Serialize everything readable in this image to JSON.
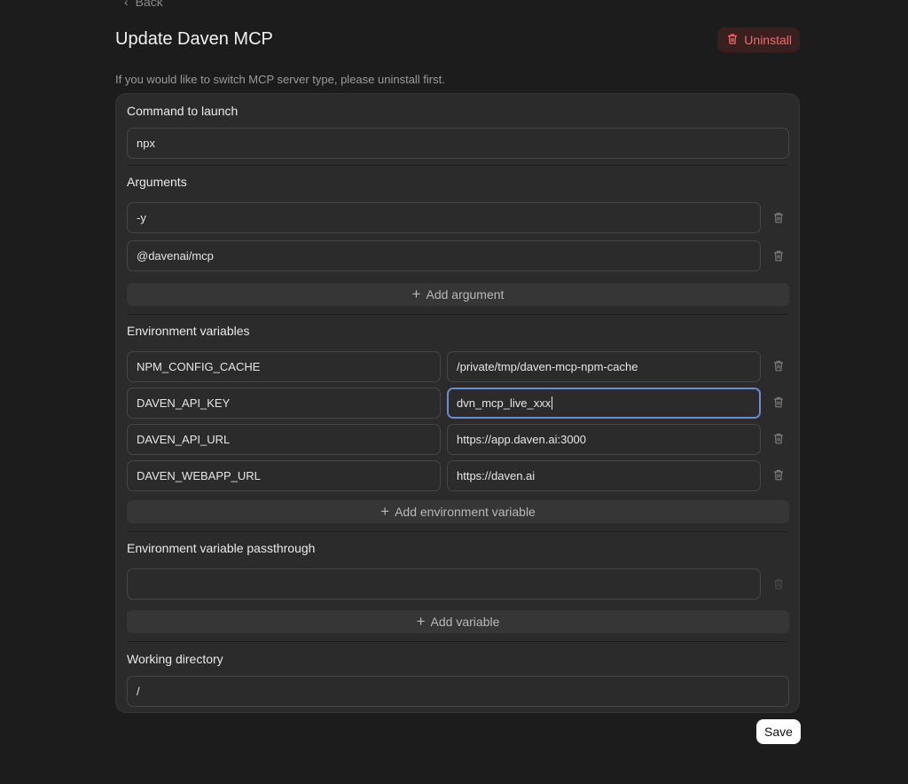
{
  "nav": {
    "back_label": "Back"
  },
  "header": {
    "title": "Update Daven MCP",
    "uninstall_label": "Uninstall"
  },
  "hint": "If you would like to switch MCP server type, please uninstall first.",
  "command": {
    "label": "Command to launch",
    "value": "npx"
  },
  "arguments": {
    "label": "Arguments",
    "items": [
      "-y",
      "@davenai/mcp"
    ],
    "add_label": "Add argument"
  },
  "env": {
    "label": "Environment variables",
    "items": [
      {
        "key": "NPM_CONFIG_CACHE",
        "value": "/private/tmp/daven-mcp-npm-cache"
      },
      {
        "key": "DAVEN_API_KEY",
        "value": "dvn_mcp_live_xxx"
      },
      {
        "key": "DAVEN_API_URL",
        "value": "https://app.daven.ai:3000"
      },
      {
        "key": "DAVEN_WEBAPP_URL",
        "value": "https://daven.ai"
      }
    ],
    "add_label": "Add environment variable"
  },
  "passthrough": {
    "label": "Environment variable passthrough",
    "items": [
      ""
    ],
    "add_label": "Add variable"
  },
  "workdir": {
    "label": "Working directory",
    "value": "/"
  },
  "save_label": "Save",
  "colors": {
    "background": "#1c1c1c",
    "panel": "#2b2b2b",
    "danger": "#f06a6a",
    "focus": "#6a8fd0"
  }
}
